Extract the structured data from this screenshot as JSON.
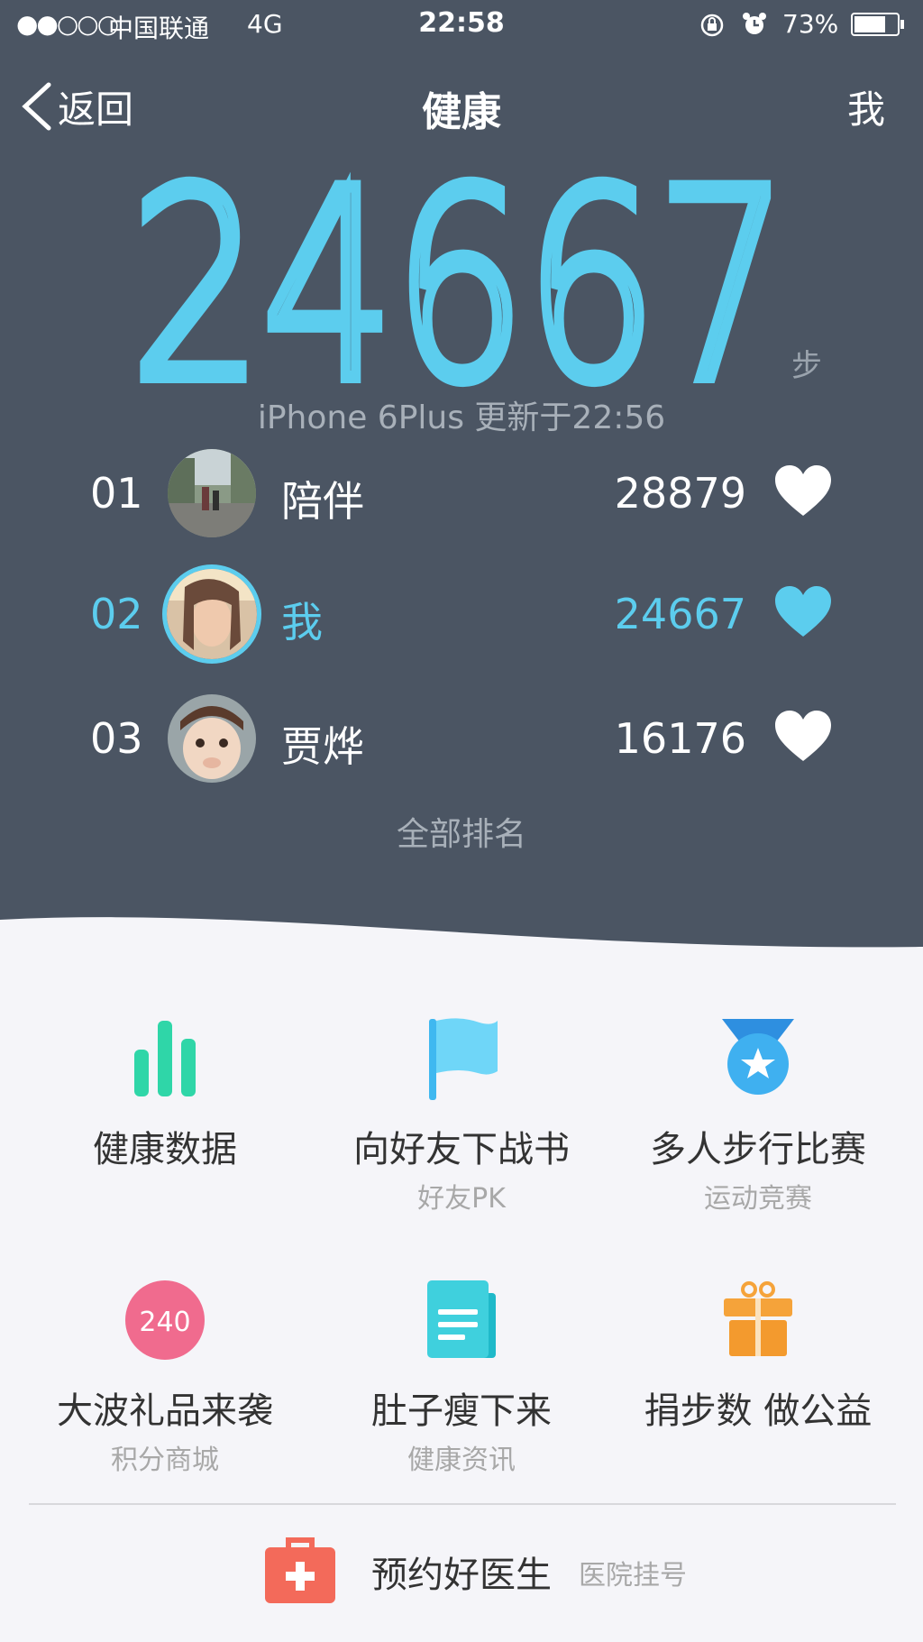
{
  "status_bar": {
    "signal": "●●○○○",
    "carrier": "中国联通",
    "network": "4G",
    "time": "22:58",
    "battery_percent": "73%",
    "battery_level": 0.73
  },
  "nav": {
    "back_label": "返回",
    "title": "健康",
    "me_label": "我"
  },
  "steps": {
    "count": "24667",
    "unit": "步",
    "device_update": "iPhone 6Plus 更新于22:56",
    "color": "#5ccdee"
  },
  "ranking": [
    {
      "rank": "01",
      "name": "陪伴",
      "steps": "28879",
      "is_me": false
    },
    {
      "rank": "02",
      "name": "我",
      "steps": "24667",
      "is_me": true
    },
    {
      "rank": "03",
      "name": "贾烨",
      "steps": "16176",
      "is_me": false
    }
  ],
  "all_rankings_label": "全部排名",
  "features": [
    {
      "label": "健康数据",
      "sub": "",
      "icon": "bar-chart-icon"
    },
    {
      "label": "向好友下战书",
      "sub": "好友PK",
      "icon": "flag-icon"
    },
    {
      "label": "多人步行比赛",
      "sub": "运动竞赛",
      "icon": "medal-icon"
    },
    {
      "label": "大波礼品来袭",
      "sub": "积分商城",
      "icon": "points-badge-icon",
      "badge": "240"
    },
    {
      "label": "肚子瘦下来",
      "sub": "健康资讯",
      "icon": "news-icon"
    },
    {
      "label": "捐步数 做公益",
      "sub": "",
      "icon": "gift-icon"
    }
  ],
  "doctor": {
    "label": "预约好医生",
    "sub": "医院挂号",
    "icon": "medical-kit-icon"
  },
  "colors": {
    "header_bg": "#4b5563",
    "accent": "#5ccdee",
    "page_bg": "#f5f5f9"
  }
}
